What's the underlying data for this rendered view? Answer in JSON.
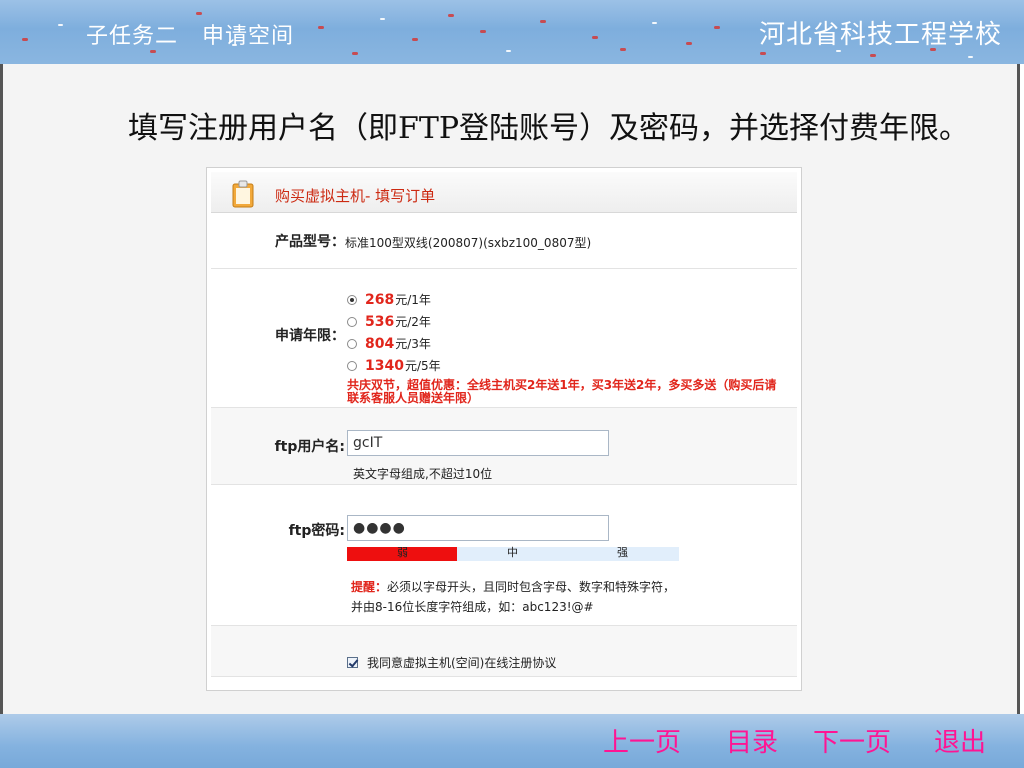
{
  "header": {
    "slide_title": "子任务二   申请空间",
    "school": "河北省科技工程学校"
  },
  "instruction": {
    "text": "填写注册用户名（即FTP登陆账号）及密码，并选择付费年限。"
  },
  "order_form": {
    "title": "购买虚拟主机- 填写订单",
    "product": {
      "label": "产品型号：",
      "value": "标准100型双线(200807)(sxbz100_0807型)"
    },
    "term": {
      "label": "申请年限：",
      "options": [
        {
          "price": "268",
          "unit": "元/1年",
          "selected": true
        },
        {
          "price": "536",
          "unit": "元/2年",
          "selected": false
        },
        {
          "price": "804",
          "unit": "元/3年",
          "selected": false
        },
        {
          "price": "1340",
          "unit": "元/5年",
          "selected": false
        }
      ],
      "promo": "共庆双节，超值优惠：全线主机买2年送1年，买3年送2年，多买多送（购买后请联系客服人员赠送年限）"
    },
    "ftp_user": {
      "label": "ftp用户名:",
      "value": "gcIT",
      "hint": "英文字母组成,不超过10位"
    },
    "ftp_password": {
      "label": "ftp密码:",
      "value": "●●●●",
      "strength_labels": [
        "弱",
        "中",
        "强"
      ],
      "strength_level": 0.33,
      "reminder_label": "提醒：",
      "reminder_text": "必须以字母开头，且同时包含字母、数字和特殊字符，并由8-16位长度字符组成，如：abc123!@#"
    },
    "agreement": {
      "label": "我同意虚拟主机(空间)在线注册协议",
      "checked": true
    }
  },
  "nav": {
    "prev": "上一页",
    "toc": "目录",
    "next": "下一页",
    "exit": "退出"
  },
  "colors": {
    "accent_red": "#e1261c",
    "nav_pink": "#ff1493",
    "banner_blue": "#7eaedd"
  }
}
